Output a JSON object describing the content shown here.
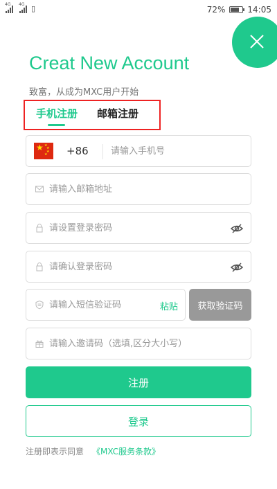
{
  "status_bar": {
    "signal_1": "4G",
    "signal_2": "4G",
    "battery": "72%",
    "battery_level": 0.72,
    "time": "14:05"
  },
  "header": {
    "title": "Creat New Account",
    "subtitle": "致富，从成为MXC用户开始"
  },
  "tabs": [
    {
      "label": "手机注册",
      "active": true
    },
    {
      "label": "邮箱注册",
      "active": false
    }
  ],
  "form": {
    "phone": {
      "country_code": "+86",
      "placeholder": "请输入手机号"
    },
    "email": {
      "placeholder": "请输入邮箱地址"
    },
    "password": {
      "placeholder": "请设置登录密码"
    },
    "confirm_password": {
      "placeholder": "请确认登录密码"
    },
    "sms_code": {
      "placeholder": "请输入短信验证码",
      "paste_label": "粘贴",
      "get_code_label": "获取验证码"
    },
    "invite_code": {
      "placeholder": "请输入邀请码（选填,区分大小写）"
    }
  },
  "buttons": {
    "register": "注册",
    "login": "登录"
  },
  "terms": {
    "prefix": "注册即表示同意",
    "link": "《MXC服务条款》"
  },
  "colors": {
    "accent": "#1fc98d",
    "highlight_border": "#ee2222",
    "disabled_button": "#999999"
  }
}
